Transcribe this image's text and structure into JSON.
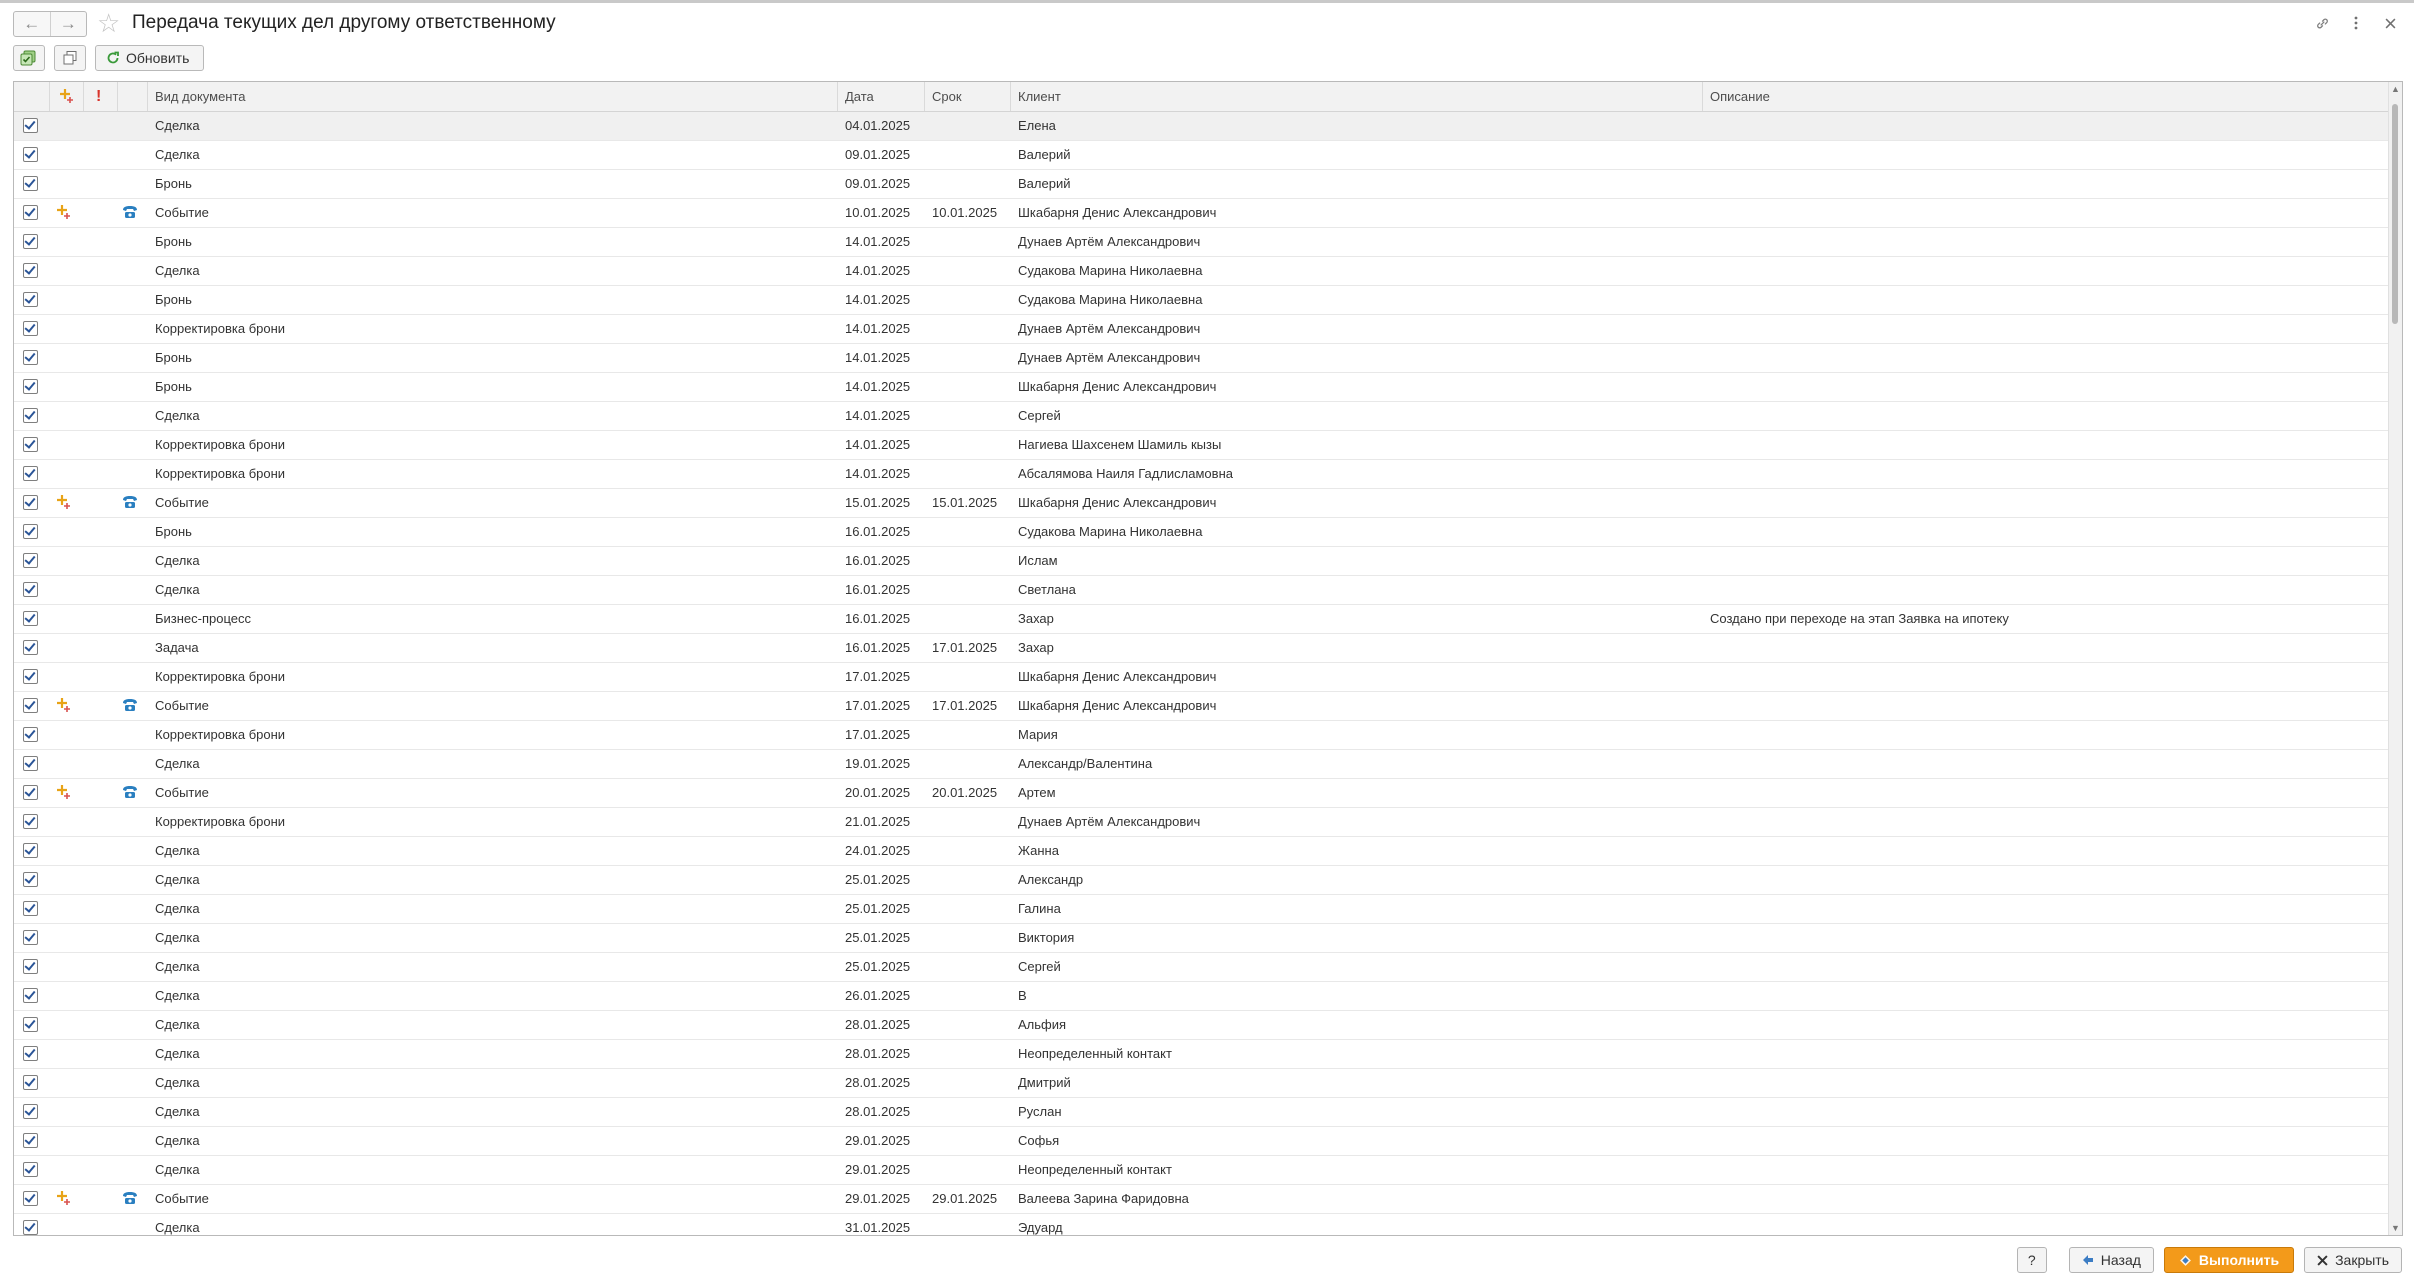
{
  "title": "Передача текущих дел другому ответственному",
  "toolbar": {
    "refresh_label": "Обновить"
  },
  "columns": [
    "Вид документа",
    "Дата",
    "Срок",
    "Клиент",
    "Описание"
  ],
  "rows": [
    {
      "checked": true,
      "new": false,
      "phone": false,
      "type": "Сделка",
      "date": "04.01.2025",
      "due": "",
      "client": "Елена",
      "desc": ""
    },
    {
      "checked": true,
      "new": false,
      "phone": false,
      "type": "Сделка",
      "date": "09.01.2025",
      "due": "",
      "client": "Валерий",
      "desc": ""
    },
    {
      "checked": true,
      "new": false,
      "phone": false,
      "type": "Бронь",
      "date": "09.01.2025",
      "due": "",
      "client": "Валерий",
      "desc": ""
    },
    {
      "checked": true,
      "new": true,
      "phone": true,
      "type": "Событие",
      "date": "10.01.2025",
      "due": "10.01.2025",
      "client": "Шкабарня Денис Александрович",
      "desc": ""
    },
    {
      "checked": true,
      "new": false,
      "phone": false,
      "type": "Бронь",
      "date": "14.01.2025",
      "due": "",
      "client": "Дунаев Артём Александрович",
      "desc": ""
    },
    {
      "checked": true,
      "new": false,
      "phone": false,
      "type": "Сделка",
      "date": "14.01.2025",
      "due": "",
      "client": "Судакова Марина Николаевна",
      "desc": ""
    },
    {
      "checked": true,
      "new": false,
      "phone": false,
      "type": "Бронь",
      "date": "14.01.2025",
      "due": "",
      "client": "Судакова Марина Николаевна",
      "desc": ""
    },
    {
      "checked": true,
      "new": false,
      "phone": false,
      "type": "Корректировка брони",
      "date": "14.01.2025",
      "due": "",
      "client": "Дунаев Артём Александрович",
      "desc": ""
    },
    {
      "checked": true,
      "new": false,
      "phone": false,
      "type": "Бронь",
      "date": "14.01.2025",
      "due": "",
      "client": "Дунаев Артём Александрович",
      "desc": ""
    },
    {
      "checked": true,
      "new": false,
      "phone": false,
      "type": "Бронь",
      "date": "14.01.2025",
      "due": "",
      "client": "Шкабарня Денис Александрович",
      "desc": ""
    },
    {
      "checked": true,
      "new": false,
      "phone": false,
      "type": "Сделка",
      "date": "14.01.2025",
      "due": "",
      "client": "Сергей",
      "desc": ""
    },
    {
      "checked": true,
      "new": false,
      "phone": false,
      "type": "Корректировка брони",
      "date": "14.01.2025",
      "due": "",
      "client": "Нагиева Шахсенем Шамиль кызы",
      "desc": ""
    },
    {
      "checked": true,
      "new": false,
      "phone": false,
      "type": "Корректировка брони",
      "date": "14.01.2025",
      "due": "",
      "client": "Абсалямова Наиля Гадлисламовна",
      "desc": ""
    },
    {
      "checked": true,
      "new": true,
      "phone": true,
      "type": "Событие",
      "date": "15.01.2025",
      "due": "15.01.2025",
      "client": "Шкабарня Денис Александрович",
      "desc": ""
    },
    {
      "checked": true,
      "new": false,
      "phone": false,
      "type": "Бронь",
      "date": "16.01.2025",
      "due": "",
      "client": "Судакова Марина Николаевна",
      "desc": ""
    },
    {
      "checked": true,
      "new": false,
      "phone": false,
      "type": "Сделка",
      "date": "16.01.2025",
      "due": "",
      "client": "Ислам",
      "desc": ""
    },
    {
      "checked": true,
      "new": false,
      "phone": false,
      "type": "Сделка",
      "date": "16.01.2025",
      "due": "",
      "client": "Светлана",
      "desc": ""
    },
    {
      "checked": true,
      "new": false,
      "phone": false,
      "type": "Бизнес-процесс",
      "date": "16.01.2025",
      "due": "",
      "client": "Захар",
      "desc": "Создано при переходе на этап Заявка на ипотеку"
    },
    {
      "checked": true,
      "new": false,
      "phone": false,
      "type": "Задача",
      "date": "16.01.2025",
      "due": "17.01.2025",
      "client": "Захар",
      "desc": ""
    },
    {
      "checked": true,
      "new": false,
      "phone": false,
      "type": "Корректировка брони",
      "date": "17.01.2025",
      "due": "",
      "client": "Шкабарня Денис Александрович",
      "desc": ""
    },
    {
      "checked": true,
      "new": true,
      "phone": true,
      "type": "Событие",
      "date": "17.01.2025",
      "due": "17.01.2025",
      "client": "Шкабарня Денис Александрович",
      "desc": ""
    },
    {
      "checked": true,
      "new": false,
      "phone": false,
      "type": "Корректировка брони",
      "date": "17.01.2025",
      "due": "",
      "client": "Мария",
      "desc": ""
    },
    {
      "checked": true,
      "new": false,
      "phone": false,
      "type": "Сделка",
      "date": "19.01.2025",
      "due": "",
      "client": "Александр/Валентина",
      "desc": ""
    },
    {
      "checked": true,
      "new": true,
      "phone": true,
      "type": "Событие",
      "date": "20.01.2025",
      "due": "20.01.2025",
      "client": "Артем",
      "desc": ""
    },
    {
      "checked": true,
      "new": false,
      "phone": false,
      "type": "Корректировка брони",
      "date": "21.01.2025",
      "due": "",
      "client": "Дунаев Артём Александрович",
      "desc": ""
    },
    {
      "checked": true,
      "new": false,
      "phone": false,
      "type": "Сделка",
      "date": "24.01.2025",
      "due": "",
      "client": "Жанна",
      "desc": ""
    },
    {
      "checked": true,
      "new": false,
      "phone": false,
      "type": "Сделка",
      "date": "25.01.2025",
      "due": "",
      "client": "Александр",
      "desc": ""
    },
    {
      "checked": true,
      "new": false,
      "phone": false,
      "type": "Сделка",
      "date": "25.01.2025",
      "due": "",
      "client": "Галина",
      "desc": ""
    },
    {
      "checked": true,
      "new": false,
      "phone": false,
      "type": "Сделка",
      "date": "25.01.2025",
      "due": "",
      "client": "Виктория",
      "desc": ""
    },
    {
      "checked": true,
      "new": false,
      "phone": false,
      "type": "Сделка",
      "date": "25.01.2025",
      "due": "",
      "client": "Сергей",
      "desc": ""
    },
    {
      "checked": true,
      "new": false,
      "phone": false,
      "type": "Сделка",
      "date": "26.01.2025",
      "due": "",
      "client": "В",
      "desc": ""
    },
    {
      "checked": true,
      "new": false,
      "phone": false,
      "type": "Сделка",
      "date": "28.01.2025",
      "due": "",
      "client": "Альфия",
      "desc": ""
    },
    {
      "checked": true,
      "new": false,
      "phone": false,
      "type": "Сделка",
      "date": "28.01.2025",
      "due": "",
      "client": "Неопределенный контакт",
      "desc": ""
    },
    {
      "checked": true,
      "new": false,
      "phone": false,
      "type": "Сделка",
      "date": "28.01.2025",
      "due": "",
      "client": "Дмитрий",
      "desc": ""
    },
    {
      "checked": true,
      "new": false,
      "phone": false,
      "type": "Сделка",
      "date": "28.01.2025",
      "due": "",
      "client": "Руслан",
      "desc": ""
    },
    {
      "checked": true,
      "new": false,
      "phone": false,
      "type": "Сделка",
      "date": "29.01.2025",
      "due": "",
      "client": "Софья",
      "desc": ""
    },
    {
      "checked": true,
      "new": false,
      "phone": false,
      "type": "Сделка",
      "date": "29.01.2025",
      "due": "",
      "client": "Неопределенный контакт",
      "desc": ""
    },
    {
      "checked": true,
      "new": true,
      "phone": true,
      "type": "Событие",
      "date": "29.01.2025",
      "due": "29.01.2025",
      "client": "Валеева Зарина Фаридовна",
      "desc": ""
    },
    {
      "checked": true,
      "new": false,
      "phone": false,
      "type": "Сделка",
      "date": "31.01.2025",
      "due": "",
      "client": "Эдуард",
      "desc": ""
    }
  ],
  "buttons": {
    "help": "?",
    "back": "Назад",
    "execute": "Выполнить",
    "close": "Закрыть"
  },
  "colors": {
    "accent": "#f39a1a",
    "checkmark": "#2b5597",
    "new_icon": "#e8a317",
    "phone_icon": "#2a7fc0"
  }
}
